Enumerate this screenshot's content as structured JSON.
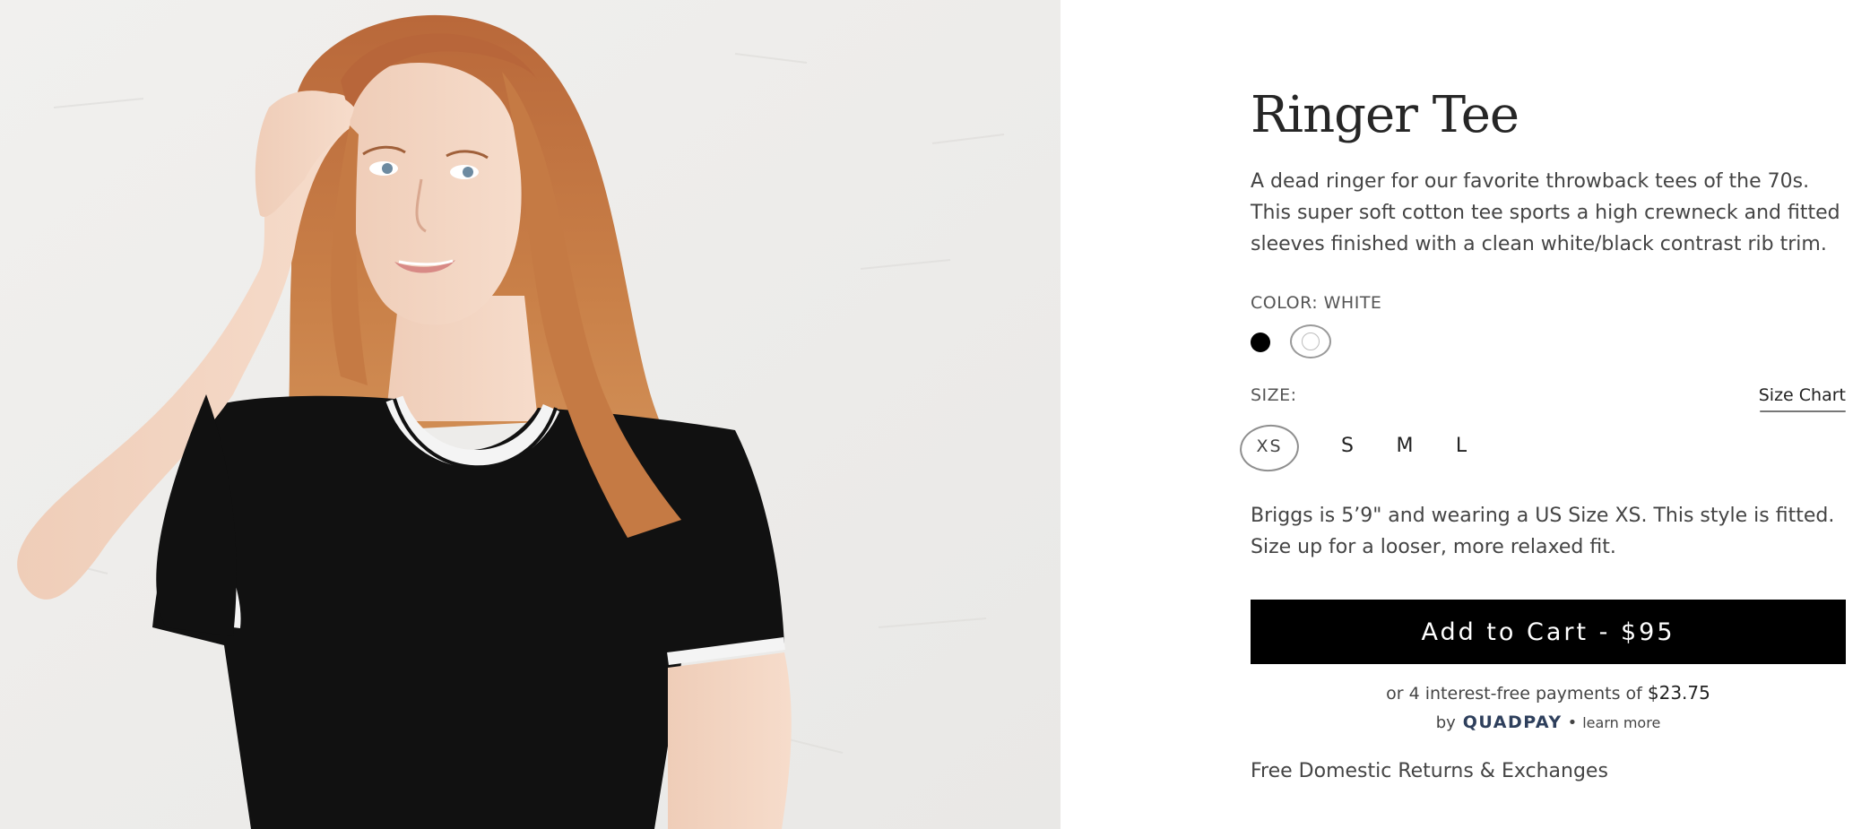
{
  "product": {
    "title": "Ringer Tee",
    "description": "A dead ringer for our favorite throwback tees of the 70s. This super soft cotton tee sports a high crewneck and fitted sleeves finished with a clean white/black contrast rib trim.",
    "image_icon": "product-photo"
  },
  "color": {
    "label": "COLOR: WHITE",
    "swatches": [
      {
        "name": "black",
        "hex": "#000000",
        "selected": false
      },
      {
        "name": "white",
        "hex": "#ffffff",
        "selected": true
      }
    ]
  },
  "size": {
    "label": "SIZE:",
    "chart_link": "Size Chart",
    "options": [
      {
        "label": "XS",
        "selected": true
      },
      {
        "label": "S",
        "selected": false
      },
      {
        "label": "M",
        "selected": false
      },
      {
        "label": "L",
        "selected": false
      }
    ]
  },
  "fit_note": "Briggs is 5’9\" and wearing a US Size XS. This style is fitted. Size up for a looser, more relaxed fit.",
  "cart": {
    "button_label": "Add to Cart - $95"
  },
  "quadpay": {
    "prefix": "or 4 interest-free payments of",
    "amount": "$23.75",
    "by": "by",
    "logo": "QUADPAY",
    "separator": "•",
    "learn_more": "learn more",
    "brand_color": "#2e3f5c"
  },
  "returns": "Free Domestic Returns & Exchanges"
}
